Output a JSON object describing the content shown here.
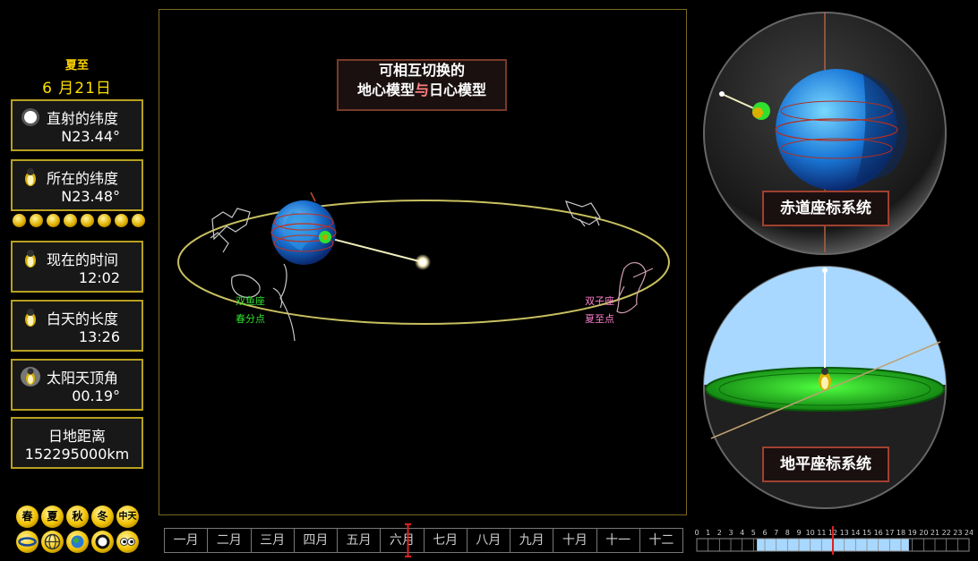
{
  "left": {
    "season": "夏至",
    "date": "6 月21日",
    "boxes": [
      {
        "title": "直射的纬度",
        "value": "N23.44°"
      },
      {
        "title": "所在的纬度",
        "value": "N23.48°"
      },
      {
        "title": "现在的时间",
        "value": "12:02"
      },
      {
        "title": "白天的长度",
        "value": "13:26"
      },
      {
        "title": "太阳天顶角",
        "value": "00.19°"
      },
      {
        "title": "日地距离",
        "value": "152295000km"
      }
    ],
    "seasons": [
      "春",
      "夏",
      "秋",
      "冬",
      "中天"
    ]
  },
  "stage": {
    "title_line1": "可相互切换的",
    "title_line2_a": "地心模型",
    "title_line2_b": "与",
    "title_line2_c": "日心模型",
    "constellations": {
      "left_label1": "双鱼座",
      "left_label2": "春分点",
      "right_label1": "双子座",
      "right_label2": "夏至点"
    }
  },
  "right": {
    "equatorial_label": "赤道座标系统",
    "horizontal_label": "地平座标系统"
  },
  "months": [
    "一月",
    "二月",
    "三月",
    "四月",
    "五月",
    "六月",
    "七月",
    "八月",
    "九月",
    "十月",
    "十一",
    "十二"
  ],
  "hours": [
    "0",
    "1",
    "2",
    "3",
    "4",
    "5",
    "6",
    "7",
    "8",
    "9",
    "10",
    "11",
    "12",
    "13",
    "14",
    "15",
    "16",
    "17",
    "18",
    "19",
    "20",
    "21",
    "22",
    "23",
    "24"
  ],
  "colors": {
    "accent": "#ffd400",
    "box_border": "#b8a020",
    "orbit": "#c8c060",
    "sky": "#a8d8ff",
    "ground": "#20c020"
  },
  "month_marker_fraction": 0.468,
  "hour_marker_fraction": 0.5,
  "daylight_start_hour": 5.3,
  "daylight_end_hour": 18.7
}
